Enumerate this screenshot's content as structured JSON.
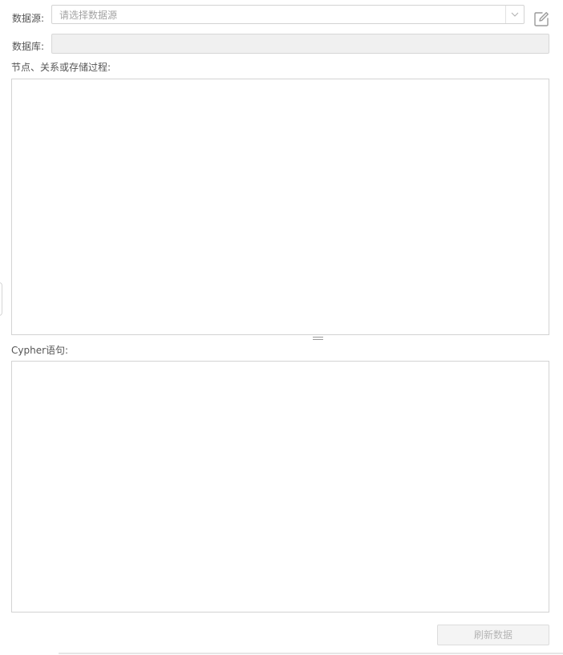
{
  "datasource": {
    "label": "数据源:",
    "placeholder": "请选择数据源"
  },
  "database": {
    "label": "数据库:",
    "value": ""
  },
  "objects_panel": {
    "label": "节点、关系或存储过程:",
    "value": ""
  },
  "cypher_panel": {
    "label": "Cypher语句:",
    "value": ""
  },
  "actions": {
    "refresh_label": "刷新数据"
  },
  "icons": {
    "dropdown": "chevron-down-icon",
    "edit": "edit-icon"
  },
  "colors": {
    "border": "#d3d3d3",
    "disabled_bg": "#f0f0f0",
    "label_text": "#555555",
    "placeholder_text": "#a3a3a3"
  }
}
